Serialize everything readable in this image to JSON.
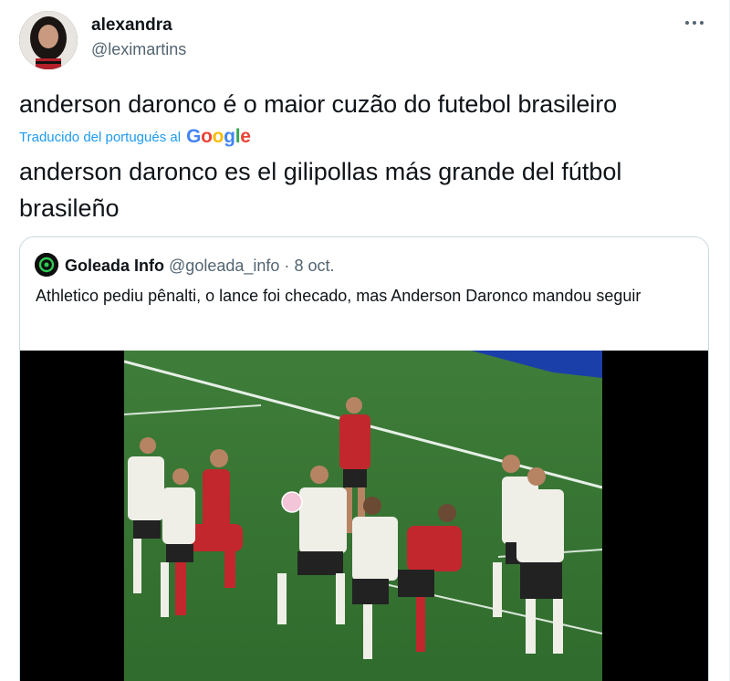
{
  "tweet": {
    "author_name": "alexandra",
    "author_handle": "@leximartins",
    "text": "anderson daronco é o maior cuzão do futebol brasileiro",
    "translation_label": "Traducido del portugués al",
    "translation_provider": "Google",
    "translated_text": "anderson daronco es el gilipollas más grande del fútbol brasileño",
    "more_icon": "more-icon"
  },
  "quoted_tweet": {
    "author_name": "Goleada Info",
    "author_handle": "@goleada_info",
    "separator": "·",
    "date": "8 oct.",
    "text": "Athletico pediu pênalti, o lance foi checado, mas Anderson Daronco mandou seguir",
    "media": "video-frame"
  },
  "colors": {
    "link_blue": "#1d9bf0",
    "secondary_text": "#536471",
    "border": "#cfd9de",
    "google_blue": "#4285f4",
    "google_red": "#ea4335",
    "google_yellow": "#fbbc05",
    "google_green": "#34a853"
  }
}
